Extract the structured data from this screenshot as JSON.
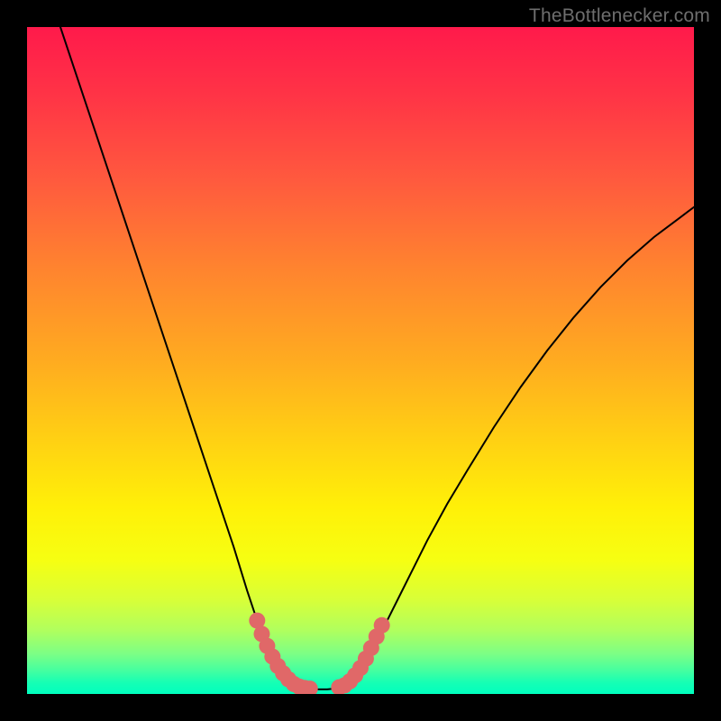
{
  "watermark": "TheBottlenecker.com",
  "chart_data": {
    "type": "line",
    "title": "",
    "xlabel": "",
    "ylabel": "",
    "xlim": [
      0,
      100
    ],
    "ylim": [
      0,
      100
    ],
    "gradient_stops": [
      {
        "offset": 0.0,
        "color": "#ff1a4b"
      },
      {
        "offset": 0.1,
        "color": "#ff3346"
      },
      {
        "offset": 0.23,
        "color": "#ff5a3e"
      },
      {
        "offset": 0.36,
        "color": "#ff832f"
      },
      {
        "offset": 0.5,
        "color": "#ffab20"
      },
      {
        "offset": 0.63,
        "color": "#ffd412"
      },
      {
        "offset": 0.72,
        "color": "#fff008"
      },
      {
        "offset": 0.8,
        "color": "#f6ff12"
      },
      {
        "offset": 0.86,
        "color": "#d7ff39"
      },
      {
        "offset": 0.905,
        "color": "#b0ff5e"
      },
      {
        "offset": 0.94,
        "color": "#7cff85"
      },
      {
        "offset": 0.965,
        "color": "#44ffa0"
      },
      {
        "offset": 0.983,
        "color": "#16ffb4"
      },
      {
        "offset": 1.0,
        "color": "#00ffbf"
      }
    ],
    "series": [
      {
        "name": "left-curve",
        "stroke": "#000000",
        "x": [
          5,
          7,
          9,
          11,
          13,
          15,
          17,
          19,
          21,
          23,
          25,
          27,
          29,
          31,
          33,
          34.5,
          36,
          37,
          38,
          39,
          40
        ],
        "y": [
          100,
          94,
          88,
          82,
          76,
          70,
          64,
          58,
          52,
          46,
          40,
          34,
          28,
          22,
          15.5,
          11,
          7,
          5,
          3.5,
          2.2,
          1.2
        ]
      },
      {
        "name": "floor-segment",
        "stroke": "#000000",
        "x": [
          40,
          41,
          42,
          43,
          44,
          45,
          46,
          47,
          48,
          49,
          50
        ],
        "y": [
          1.2,
          0.9,
          0.8,
          0.7,
          0.7,
          0.7,
          0.8,
          1.0,
          1.5,
          2.3,
          3.5
        ]
      },
      {
        "name": "right-curve",
        "stroke": "#000000",
        "x": [
          50,
          52,
          54,
          56,
          58,
          60,
          63,
          66,
          70,
          74,
          78,
          82,
          86,
          90,
          94,
          98,
          100
        ],
        "y": [
          3.5,
          7,
          11,
          15,
          19,
          23,
          28.5,
          33.5,
          40,
          46,
          51.5,
          56.5,
          61,
          65,
          68.5,
          71.5,
          73
        ]
      },
      {
        "name": "marker-cluster-left",
        "stroke": "#e06868",
        "style": "thick",
        "x": [
          34.5,
          35.2,
          36.0,
          36.8,
          37.6,
          38.4,
          39.2,
          40.0,
          40.8,
          41.6,
          42.4
        ],
        "y": [
          11.0,
          9.0,
          7.2,
          5.6,
          4.2,
          3.1,
          2.2,
          1.5,
          1.1,
          0.9,
          0.8
        ]
      },
      {
        "name": "marker-cluster-right",
        "stroke": "#e06868",
        "style": "thick",
        "x": [
          46.8,
          47.6,
          48.4,
          49.2,
          50.0,
          50.8,
          51.6,
          52.4,
          53.2
        ],
        "y": [
          1.0,
          1.3,
          1.9,
          2.8,
          3.9,
          5.3,
          6.9,
          8.6,
          10.3
        ]
      }
    ]
  }
}
